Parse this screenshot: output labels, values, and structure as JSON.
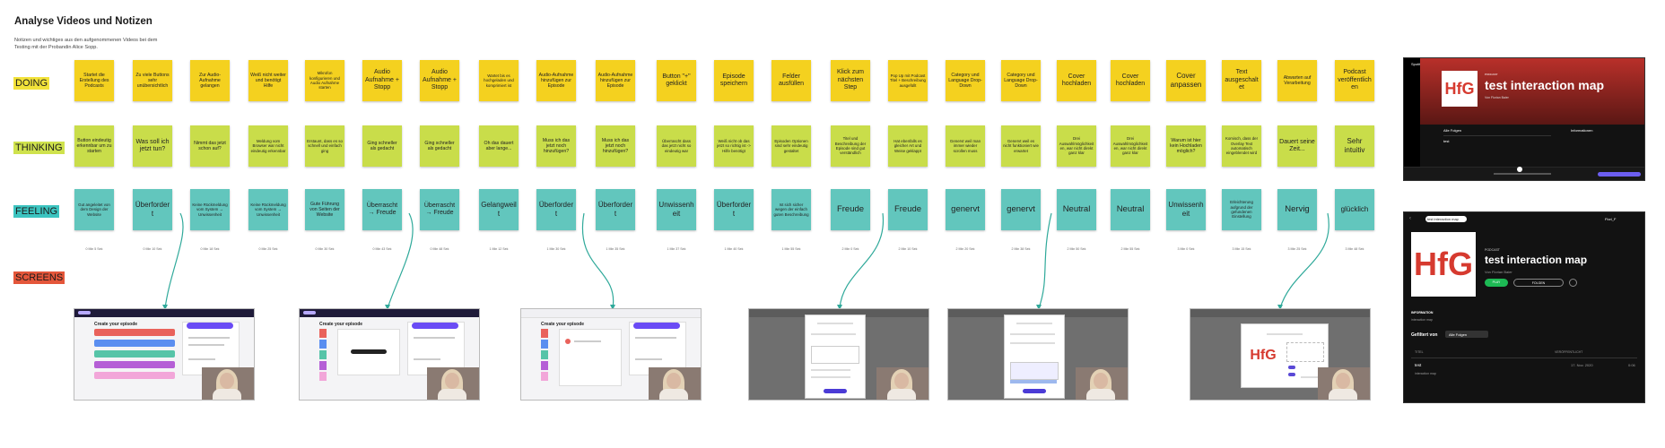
{
  "title": "Analyse Videos und Notizen",
  "subtitle": "Notizen und wichtiges aus den aufgenommenen Videos bei dem Testing mit der Probandin Alice Sopp.",
  "rows": {
    "doing": "DOING",
    "thinking": "THINKING",
    "feeling": "FEELING",
    "screens": "SCREENS"
  },
  "colors": {
    "doing": "#f4d11f",
    "thinking": "#c9dd4a",
    "feeling": "#62c6bd",
    "screens_label": "#e65a3a",
    "connector": "#2fa99a"
  },
  "doing": [
    "Startet die Erstellung des Podcasts",
    "Zu viele Buttons sehr unübersichtlich",
    "Zur Audio-Aufnahme gelangen",
    "Weiß nicht weiter und benötigt Hilfe",
    "Mikrofon konfigurieren und Audio Aufnahme starten",
    "Audio Aufnahme + Stopp",
    "Audio Aufnahme + Stopp",
    "Wartet bis es hochgeladen und komprimiert ist",
    "Audio-Aufnahme hinzufügen zur Episode",
    "Audio-Aufnahme hinzufügen zur Episode",
    "Button \"+\" geklickt",
    "Episode speichern",
    "Felder ausfüllen",
    "Klick zum nächsten Step",
    "Pop Up mit Podcast Titel + Beschreibung ausgefüllt",
    "Category und Language Drop-Down",
    "Category und Language Drop-Down",
    "Cover hochladen",
    "Cover hochladen",
    "Cover anpassen",
    "Text ausgeschaltet",
    "Abwarten auf Verarbeitung",
    "Podcast veröffentlichen"
  ],
  "thinking": [
    "Button eindeutig erkennbar um zu starten",
    "Was soll ich jetzt tun?",
    "Nimmt das jetzt schon auf?",
    "Meldung vom Browser war nicht eindeutig erkennbar",
    "Erstaunt, dass es so schnell und einfach ging",
    "Ging schneller als gedacht",
    "Ging schneller als gedacht",
    "Oh das dauert aber lange...",
    "Muss ich das jetzt noch hinzufügen?",
    "Muss ich das jetzt noch hinzufügen?",
    "Überrascht dass das jetzt nicht so eindeutig war",
    "Weiß nicht ob das jetzt so richtig ist -> Hilfe benötigt",
    "Episoden Optionen sind sehr eindeutig gestaltet",
    "Titel und Beschreibung der Episode sind gut verständlich",
    "Hat ebenfalls es gleicher Art und Weise geklappt",
    "Genervt weil man immer wieder scrollen muss",
    "Genervt weil es nicht funktioniert wie erwartet",
    "Drei Auswahlmöglichkeiten, war nicht direkt ganz klar",
    "Drei Auswahlmöglichkeiten, war nicht direkt ganz klar",
    "Warum ist hier kein Hochladen möglich?",
    "Komisch, dass der Overlay Text automatisch eingeblendet wird",
    "Dauert seine Zeit...",
    "Sehr intuitiv"
  ],
  "feeling": [
    "Gut angeleitet von dem Design der Website",
    "Überfordert",
    "Keine Rückmeldung vom System → Unwissenheit",
    "Keine Rückmeldung vom System → Unwissenheit",
    "Gute Führung von Seiten der Website",
    "Überrascht → Freude",
    "Überrascht → Freude",
    "Gelangweilt",
    "Überfordert",
    "Überfordert",
    "Unwissenheit",
    "Überfordert",
    "Ist sich sicher wegen der einfach guten Beschreibung",
    "Freude",
    "Freude",
    "genervt",
    "genervt",
    "Neutral",
    "Neutral",
    "Unwissenheit",
    "Erleichterung aufgrund der gefundenen Einstellung",
    "Nervig",
    "glücklich"
  ],
  "timestamps": [
    "0 Min 5 Sek",
    "0 Min 10 Sek",
    "0 Min 18 Sek",
    "0 Min 25 Sek",
    "0 Min 30 Sek",
    "0 Min 43 Sek",
    "0 Min 48 Sek",
    "1 Min 12 Sek",
    "1 Min 30 Sek",
    "1 Min 35 Sek",
    "1 Min 37 Sek",
    "1 Min 40 Sek",
    "1 Min 55 Sek",
    "2 Min 0 Sek",
    "2 Min 10 Sek",
    "2 Min 20 Sek",
    "2 Min 38 Sek",
    "2 Min 50 Sek",
    "2 Min 55 Sek",
    "3 Min 0 Sek",
    "3 Min 15 Sek",
    "3 Min 25 Sek",
    "3 Min 48 Sek"
  ],
  "screen_create": "Create your episode",
  "spotify": {
    "brand": "Spotify",
    "hfg": "HfG",
    "podcast_label": "PODCAST",
    "podcast_title": "test interaction map",
    "author": "Von Florian Baier",
    "follow": "FOLGEN",
    "play": "PLAY",
    "information": "INFORMATION",
    "info_text": "interaction map",
    "filter_label": "Gefiltert von",
    "filter_value": "Alle Folgen",
    "col_title": "TITEL",
    "col_date": "VERÖFFENTLICHT",
    "episode_title": "test",
    "episode_date": "17. Nov. 2020",
    "episode_dur": "0:06",
    "episode_sub": "interaction map",
    "episodes_label": "Alle Folgen",
    "info_label": "Informationen",
    "user": "Flori_F"
  }
}
